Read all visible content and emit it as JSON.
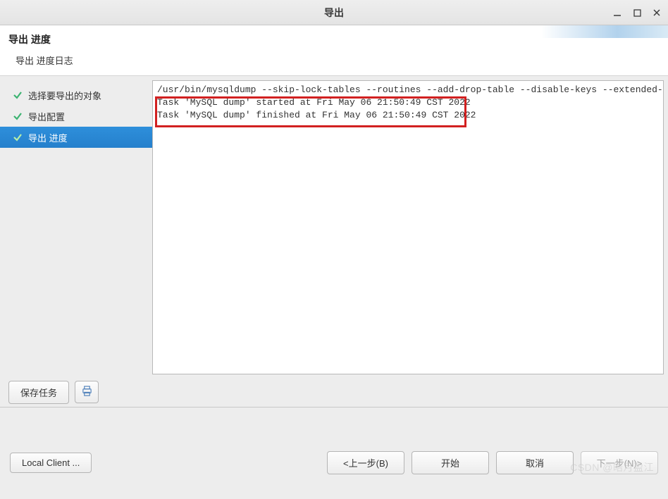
{
  "window": {
    "title": "导出"
  },
  "header": {
    "title": "导出 进度",
    "subtitle": "导出 进度日志"
  },
  "sidebar": {
    "items": [
      {
        "label": "选择要导出的对象"
      },
      {
        "label": "导出配置"
      },
      {
        "label": "导出 进度"
      }
    ]
  },
  "log": {
    "lines": [
      "/usr/bin/mysqldump --skip-lock-tables --routines --add-drop-table --disable-keys --extended-insert -u ro",
      "Task 'MySQL dump' started at Fri May 06 21:50:49 CST 2022",
      "Task 'MySQL dump' finished at Fri May 06 21:50:49 CST 2022"
    ]
  },
  "toolbar": {
    "save_task": "保存任务"
  },
  "bottom": {
    "local_client": "Local Client ...",
    "prev": "<上一步(B)",
    "start": "开始",
    "cancel": "取消",
    "next": "下一步(N)>"
  },
  "watermark": "CSDN @皓月盈江"
}
